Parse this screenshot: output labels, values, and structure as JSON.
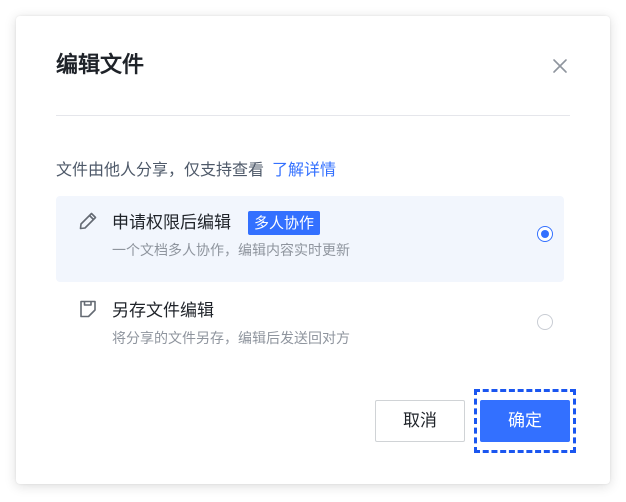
{
  "dialog": {
    "title": "编辑文件",
    "close_icon": "close-icon",
    "info_text": "文件由他人分享，仅支持查看",
    "info_link": "了解详情",
    "options": [
      {
        "icon": "pencil-icon",
        "title": "申请权限后编辑",
        "tag": "多人协作",
        "description": "一个文档多人协作，编辑内容实时更新",
        "selected": true
      },
      {
        "icon": "save-copy-icon",
        "title": "另存文件编辑",
        "description": "将分享的文件另存，编辑后发送回对方",
        "selected": false
      }
    ],
    "cancel_label": "取消",
    "confirm_label": "确定"
  },
  "colors": {
    "accent": "#3370ff",
    "selected_background": "#f2f6fd",
    "focus_outline": "#1a56f0"
  }
}
